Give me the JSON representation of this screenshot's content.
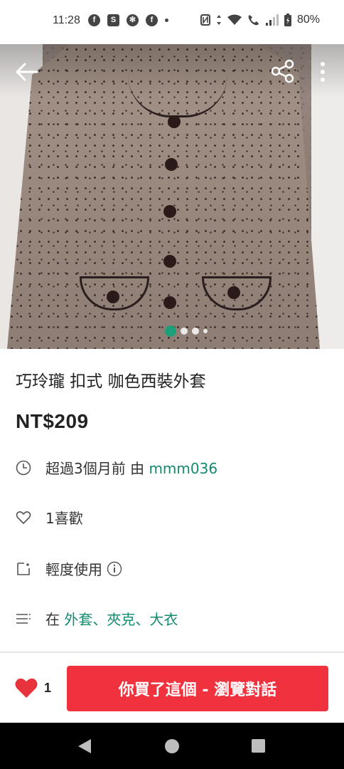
{
  "status_bar": {
    "time": "11:28",
    "notification_icons": [
      "facebook-icon",
      "shopping-bag-icon",
      "app-icon",
      "facebook-icon",
      "dot-icon"
    ],
    "battery": "80%"
  },
  "header": {
    "back_icon": "arrow-left-icon",
    "share_icon": "share-icon",
    "more_icon": "more-vert-icon"
  },
  "gallery": {
    "image_count": 4,
    "active_index": 0
  },
  "product": {
    "title": "巧玲瓏 扣式 咖色西裝外套",
    "price": "NT$209",
    "time_prefix": "超過3個月前 由 ",
    "seller": "mmm036",
    "likes_text": "1喜歡",
    "condition": "輕度使用",
    "category_prefix": "在 ",
    "category": "外套、夾克、大衣"
  },
  "bottom_bar": {
    "like_count": "1",
    "cta_label": "你買了這個 - 瀏覽對話"
  },
  "colors": {
    "accent_green": "#1f9e7a",
    "cta_red": "#f0323e",
    "heart_red": "#e8323c"
  }
}
